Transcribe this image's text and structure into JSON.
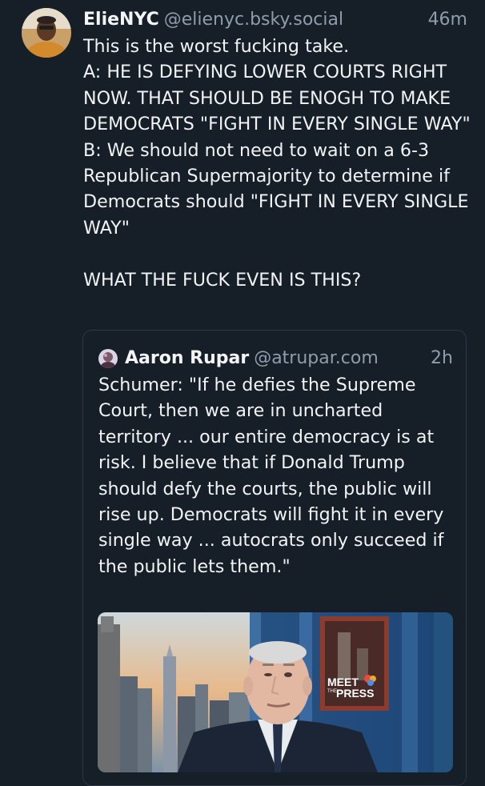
{
  "post": {
    "author_name": "ElieNYC",
    "author_handle": "@elienyc.bsky.social",
    "timestamp": "46m",
    "text": "This is the worst fucking take.\nA: HE IS DEFYING LOWER COURTS RIGHT NOW. THAT SHOULD BE ENOGH TO MAKE DEMOCRATS \"FIGHT IN EVERY SINGLE WAY\"\nB: We should not need to wait on a 6-3 Republican Supermajority to determine if Democrats should \"FIGHT IN EVERY SINGLE WAY\"\n\nWHAT THE FUCK EVEN IS THIS?"
  },
  "quote": {
    "author_name": "Aaron Rupar",
    "author_handle": "@atrupar.com",
    "timestamp": "2h",
    "text": "Schumer: \"If he defies the Supreme Court, then we are in uncharted territory ... our entire democracy is at risk. I believe that if Donald Trump should defy the courts, the public will rise up. Democrats will fight it in every single way ... autocrats only succeed if the public lets them.\"",
    "image": {
      "logo_line1": "MEET",
      "logo_line2": "THE",
      "logo_line3": "PRESS"
    }
  },
  "colors": {
    "background": "#161e27",
    "text": "#f1f3f5",
    "muted": "#8e9cab",
    "border": "#2c3845"
  }
}
